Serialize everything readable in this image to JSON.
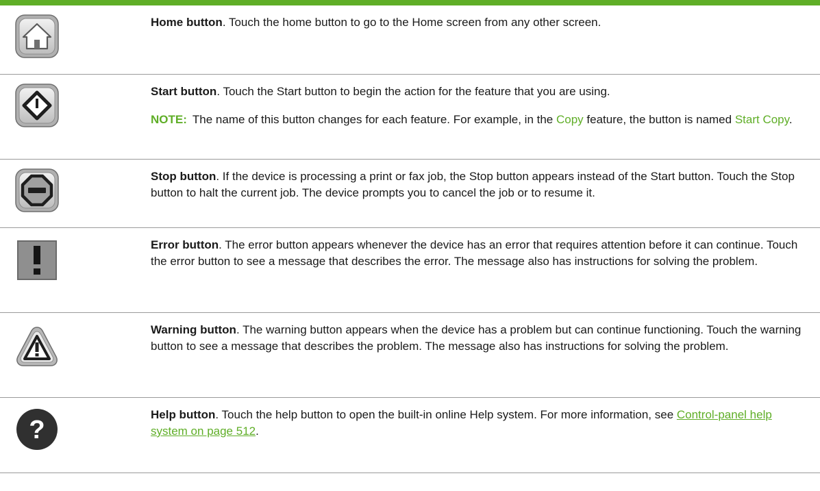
{
  "colors": {
    "accent": "#5fae27",
    "rule": "#9a9a9a"
  },
  "rows": [
    {
      "icon": "home-icon",
      "title": "Home button",
      "body": ". Touch the home button to go to the Home screen from any other screen."
    },
    {
      "icon": "start-icon",
      "title": "Start button",
      "body": ". Touch the Start button to begin the action for the feature that you are using.",
      "note": {
        "label": "NOTE:",
        "text_1": "The name of this button changes for each feature. For example, in the ",
        "term_1": "Copy",
        "text_2": " feature, the button is named ",
        "term_2": "Start Copy",
        "text_3": "."
      }
    },
    {
      "icon": "stop-icon",
      "title": "Stop button",
      "body": ". If the device is processing a print or fax job, the Stop button appears instead of the Start button. Touch the Stop button to halt the current job. The device prompts you to cancel the job or to resume it."
    },
    {
      "icon": "error-icon",
      "title": "Error button",
      "body": ". The error button appears whenever the device has an error that requires attention before it can continue. Touch the error button to see a message that describes the error. The message also has instructions for solving the problem."
    },
    {
      "icon": "warning-icon",
      "title": "Warning button",
      "body": ". The warning button appears when the device has a problem but can continue functioning. Touch the warning button to see a message that describes the problem. The message also has instructions for solving the problem."
    },
    {
      "icon": "help-icon",
      "title": "Help button",
      "body": ". Touch the help button to open the built-in online Help system. For more information, see ",
      "link": "Control-panel help system on page 512",
      "tail": "."
    }
  ]
}
